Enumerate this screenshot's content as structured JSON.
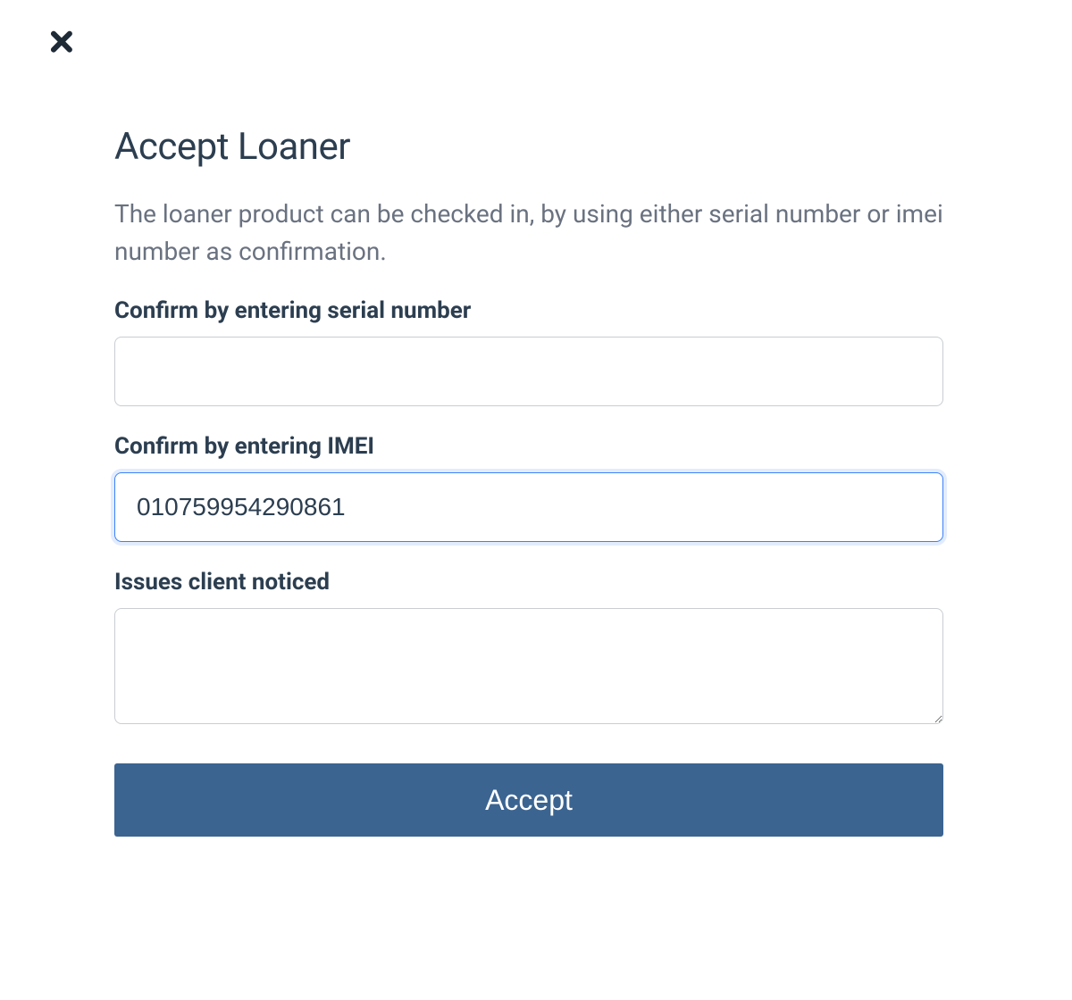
{
  "dialog": {
    "title": "Accept Loaner",
    "description": "The loaner product can be checked in, by using either serial number or imei number as confirmation.",
    "serial_label": "Confirm by entering serial number",
    "serial_value": "",
    "imei_label": "Confirm by entering IMEI",
    "imei_value": "010759954290861",
    "issues_label": "Issues client noticed",
    "issues_value": "",
    "accept_label": "Accept"
  },
  "icons": {
    "close": "close-icon"
  }
}
